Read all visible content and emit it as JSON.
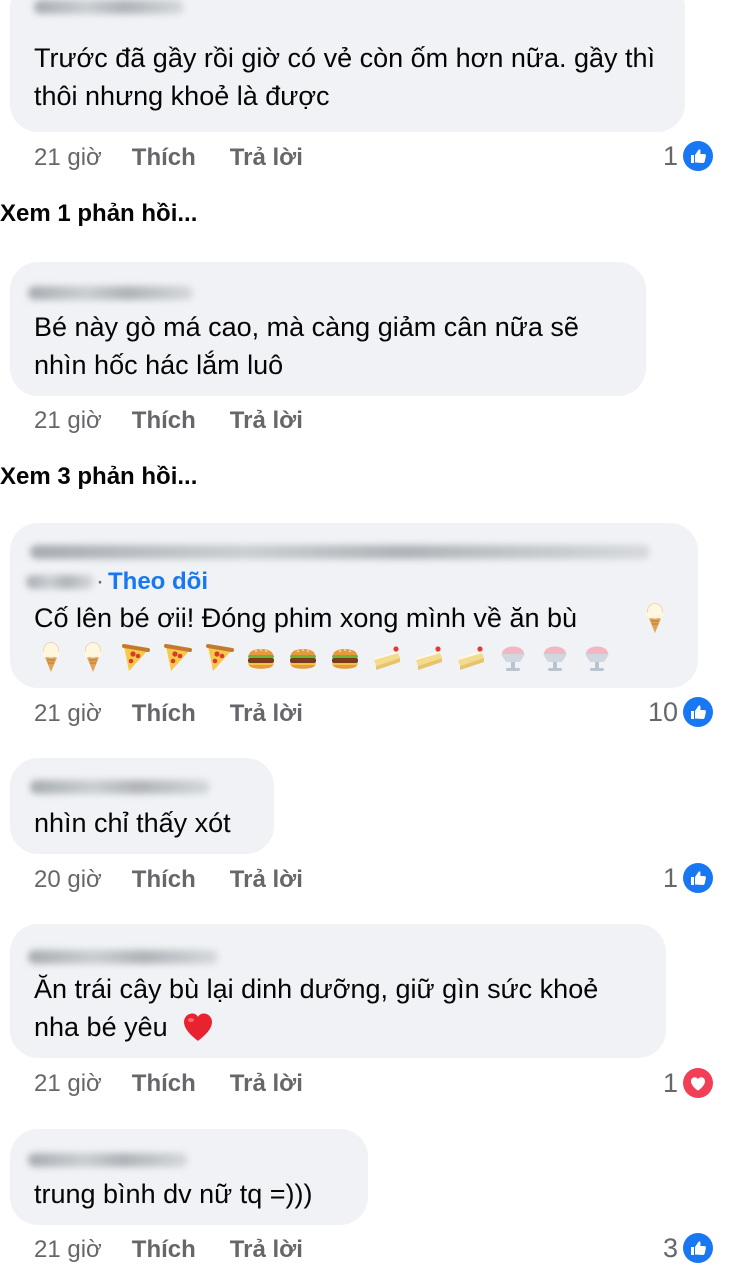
{
  "comments": [
    {
      "text": "Trước đã gầy rồi giờ có vẻ còn ốm hơn nữa. gầy thì thôi nhưng khoẻ là được",
      "time": "21 giờ",
      "like_label": "Thích",
      "reply_label": "Trả lời",
      "reaction_count": "1",
      "reaction_icon": "like-icon",
      "view_replies": "Xem 1 phản hồi..."
    },
    {
      "text": "Bé này gò má cao, mà càng giảm cân nữa sẽ nhìn hốc hác lắm luô",
      "time": "21 giờ",
      "like_label": "Thích",
      "reply_label": "Trả lời",
      "view_replies": "Xem 3 phản hồi..."
    },
    {
      "follow_label": "Theo dõi",
      "text": "Cố lên bé ơii! Đóng phim xong mình về ăn bù",
      "emojis": [
        "ice-cream",
        "ice-cream",
        "ice-cream",
        "pizza",
        "pizza",
        "pizza",
        "burger",
        "burger",
        "burger",
        "cake",
        "cake",
        "cake",
        "shaved-ice",
        "shaved-ice",
        "shaved-ice"
      ],
      "time": "21 giờ",
      "like_label": "Thích",
      "reply_label": "Trả lời",
      "reaction_count": "10",
      "reaction_icon": "like-icon"
    },
    {
      "text": "nhìn chỉ thấy xót",
      "time": "20 giờ",
      "like_label": "Thích",
      "reply_label": "Trả lời",
      "reaction_count": "1",
      "reaction_icon": "like-icon"
    },
    {
      "text": "Ăn trái cây bù lại dinh dưỡng, giữ gìn sức khoẻ nha bé yêu",
      "text_emoji": "heart",
      "time": "21 giờ",
      "like_label": "Thích",
      "reply_label": "Trả lời",
      "reaction_count": "1",
      "reaction_icon": "love-icon"
    },
    {
      "text": "trung bình dv nữ tq =)))",
      "time": "21 giờ",
      "like_label": "Thích",
      "reply_label": "Trả lời",
      "reaction_count": "3",
      "reaction_icon": "like-icon"
    }
  ],
  "colors": {
    "bubble_bg": "#f0f2f5",
    "meta_text": "#65676b",
    "like_blue": "#1877f2",
    "love_red": "#f33e58"
  }
}
